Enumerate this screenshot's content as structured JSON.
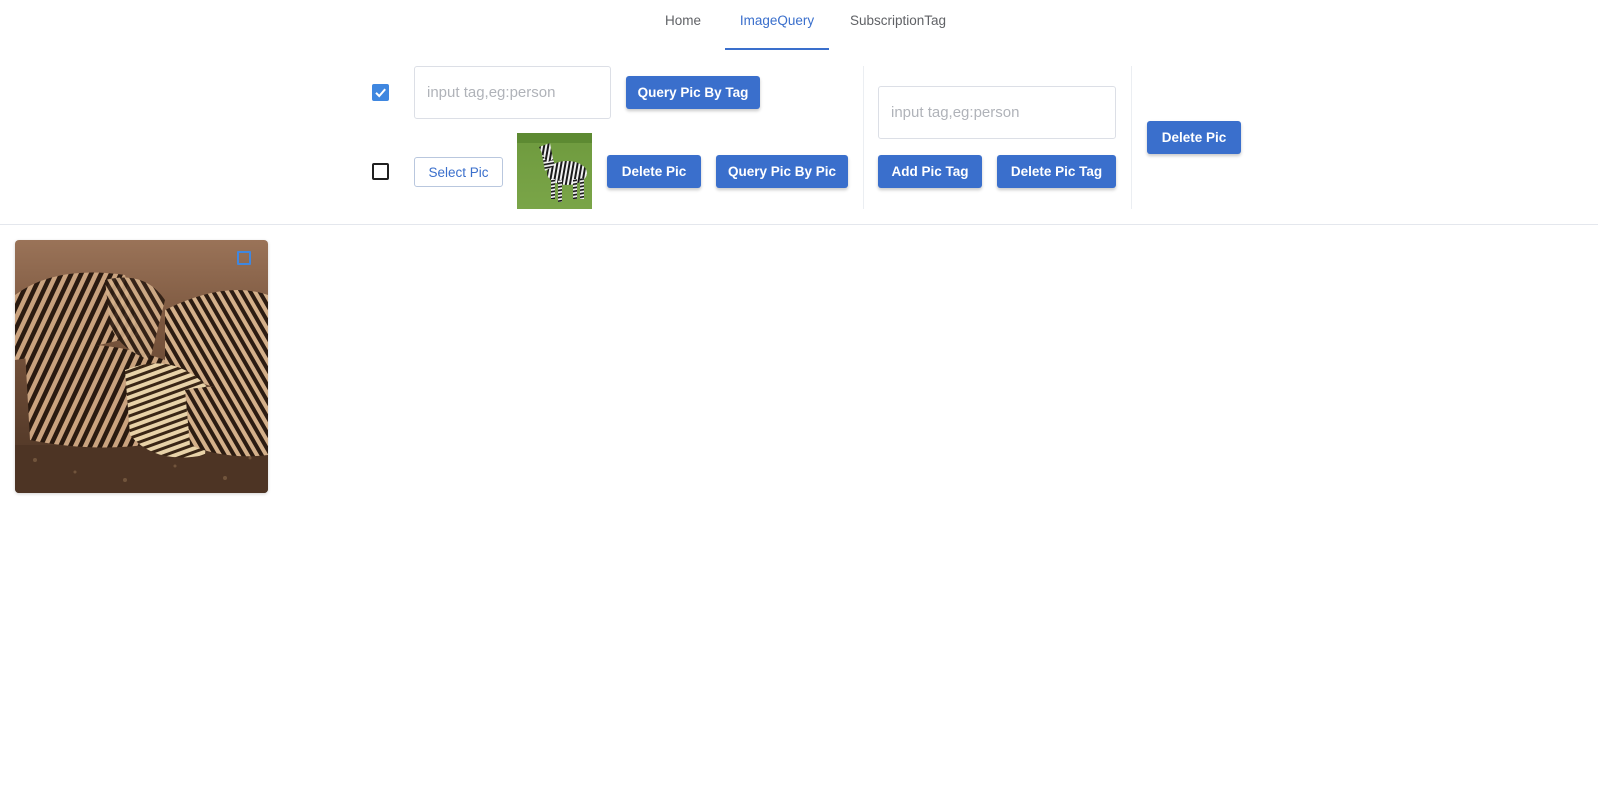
{
  "tabs": [
    {
      "label": "Home",
      "active": false
    },
    {
      "label": "ImageQuery",
      "active": true
    },
    {
      "label": "SubscriptionTag",
      "active": false
    }
  ],
  "query_panel": {
    "tag_mode_checked": true,
    "tag_input_placeholder": "input tag,eg:person",
    "tag_input_value": "",
    "query_by_tag_label": "Query Pic By Tag",
    "pic_mode_checked": false,
    "select_pic_label": "Select Pic",
    "delete_pic_label": "Delete Pic",
    "query_by_pic_label": "Query Pic By Pic"
  },
  "tag_panel": {
    "tag_input_placeholder": "input tag,eg:person",
    "tag_input_value": "",
    "add_tag_label": "Add Pic Tag",
    "delete_tag_label": "Delete Pic Tag"
  },
  "delete_panel": {
    "delete_pic_label": "Delete Pic"
  },
  "results": [
    {
      "image": "zebra-herd-sepia",
      "selected": true
    }
  ],
  "colors": {
    "accent": "#3a6fcc",
    "checkbox": "#3f87e0"
  }
}
